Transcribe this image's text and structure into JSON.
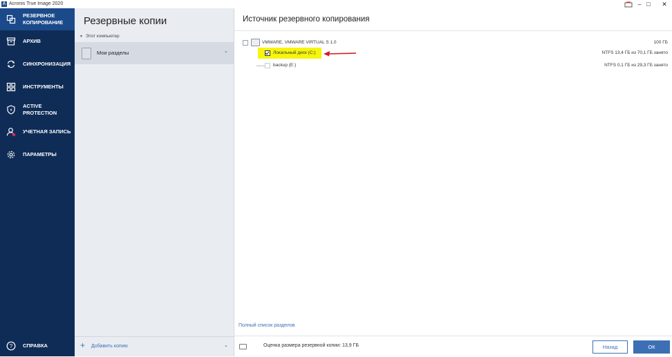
{
  "window": {
    "app_icon": "A",
    "title": "Acronis True Image 2020",
    "controls": {
      "minimize": "–",
      "maximize": "□",
      "close": "✕"
    }
  },
  "sidebar": {
    "items": [
      {
        "label": "РЕЗЕРВНОЕ КОПИРОВАНИЕ",
        "icon": "copy-icon",
        "active": true
      },
      {
        "label": "АРХИВ",
        "icon": "archive-icon"
      },
      {
        "label": "СИНХРОНИЗАЦИЯ",
        "icon": "sync-icon"
      },
      {
        "label": "ИНСТРУМЕНТЫ",
        "icon": "grid-icon"
      },
      {
        "label": "ACTIVE PROTECTION",
        "icon": "shield-icon"
      },
      {
        "label": "УЧЕТНАЯ ЗАПИСЬ",
        "icon": "user-icon"
      },
      {
        "label": "ПАРАМЕТРЫ",
        "icon": "gear-icon"
      }
    ],
    "help": {
      "label": "СПРАВКА",
      "icon": "help-icon"
    },
    "colors": {
      "background": "#0f2c57",
      "active": "#1b4a8a"
    }
  },
  "backups": {
    "title": "Резервные копии",
    "group": "Этот компьютер",
    "item": "Мои разделы",
    "add_label": "Добавить копию"
  },
  "source": {
    "title": "Источник резервного копирования",
    "disk": {
      "name": "VMWARE, VMWARE VIRTUAL S 1.0",
      "size": "100 ГБ"
    },
    "partitions": [
      {
        "name": "Локальный диск (C:)",
        "info": "NTFS 13,4 ГБ из 70,1 ГБ занято",
        "checked": true,
        "highlight": "#f5f50e"
      },
      {
        "name": "backup (E:)",
        "info": "NTFS 0,1 ГБ из 29,3 ГБ занято",
        "checked": false
      }
    ],
    "full_list_link": "Полный список разделов",
    "estimate": "Оценка размера резервной копии: 13,9 ГБ",
    "cancel_label": "Назад",
    "ok_label": "ОК",
    "accent": "#3d6fb5",
    "arrow_color": "#d71920"
  }
}
